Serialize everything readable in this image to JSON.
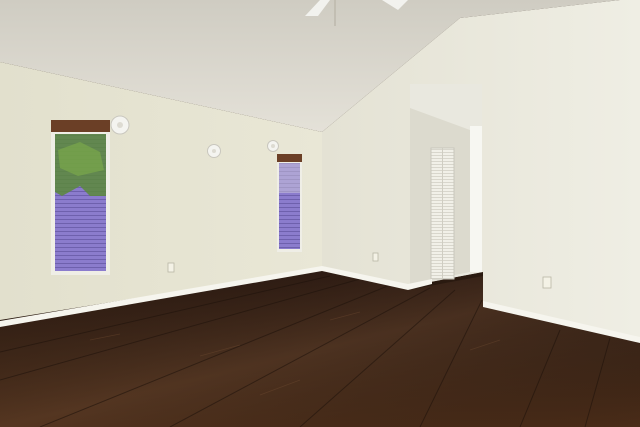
{
  "scene": {
    "subject": "empty-room",
    "colors": {
      "ceiling": "#d8d5cc",
      "wall_left": "#e6e4d2",
      "wall_right": "#ecebe0",
      "floor": "#3a2418",
      "trim": "#f4f3ec",
      "window_sky": "#8a78c8",
      "foliage": "#5a8a3a"
    }
  }
}
